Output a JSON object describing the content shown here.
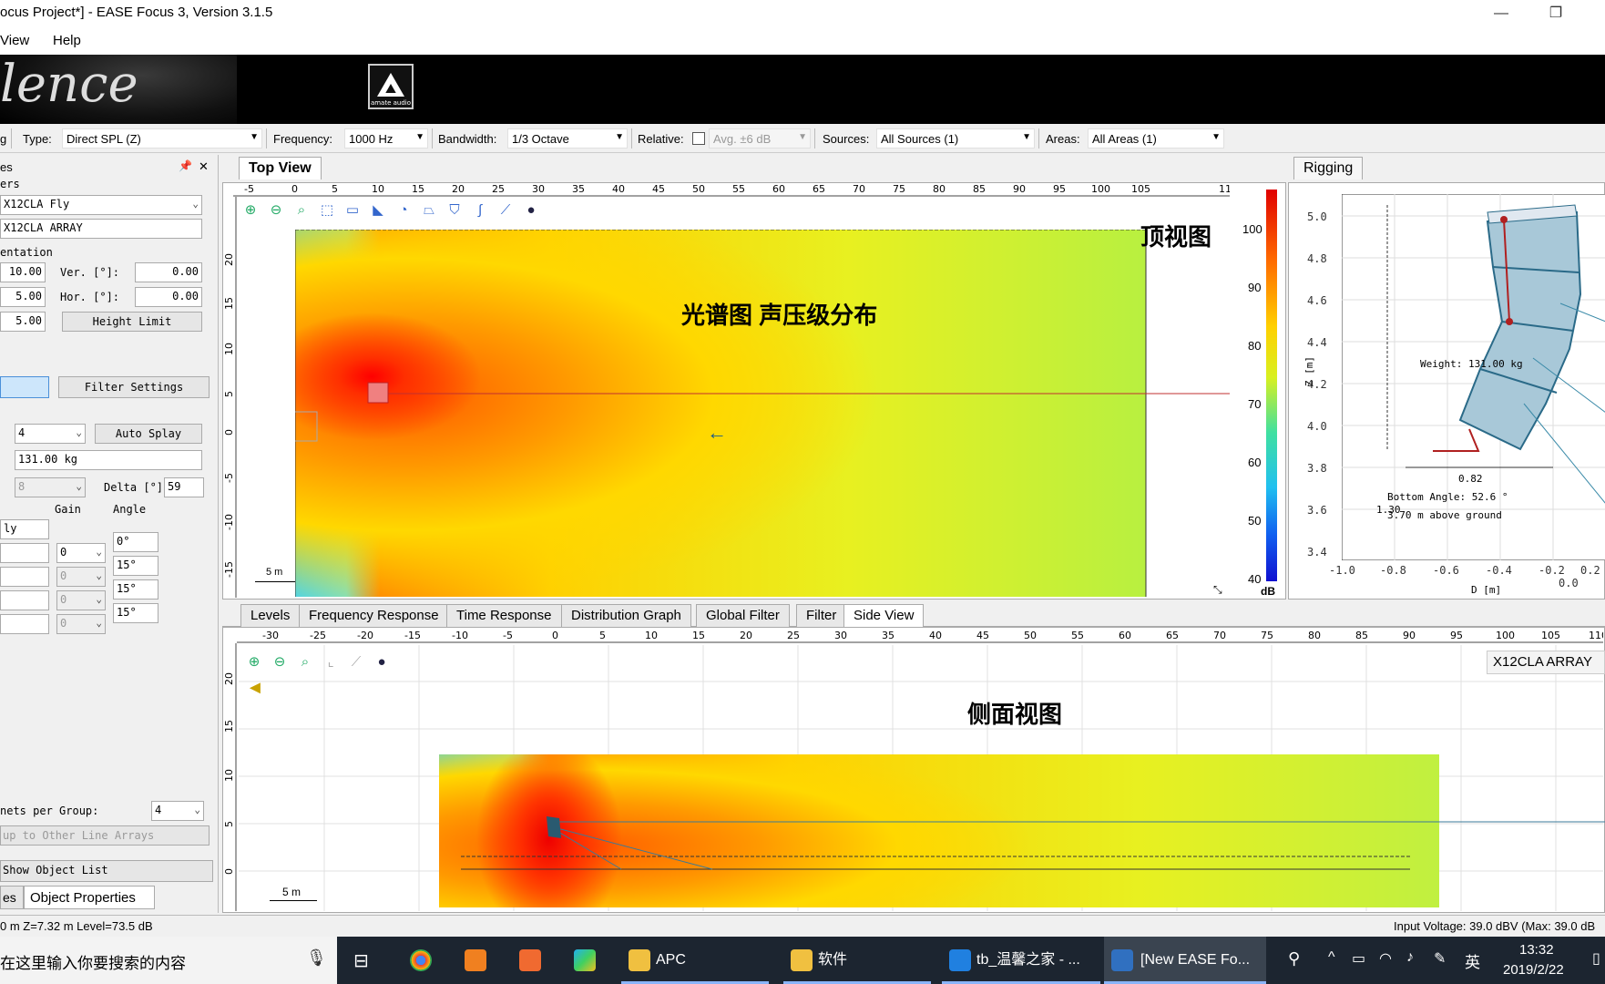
{
  "window": {
    "title": "ocus Project*] - EASE Focus 3, Version 3.1.5",
    "minimize": "—",
    "restore": "❐"
  },
  "menu": [
    "View",
    "Help"
  ],
  "banner": {
    "logo_text": "lence",
    "brand_logo_label": "amate audio"
  },
  "toolbar": {
    "partial_left": "g",
    "type_label": "Type:",
    "type_value": "Direct SPL (Z)",
    "frequency_label": "Frequency:",
    "frequency_value": "1000 Hz",
    "bandwidth_label": "Bandwidth:",
    "bandwidth_value": "1/3 Octave",
    "relative_label": "Relative:",
    "relative_value": "Avg. ±6 dB",
    "sources_label": "Sources:",
    "sources_value": "All Sources (1)",
    "areas_label": "Areas:",
    "areas_value": "All Areas (1)"
  },
  "left_panel": {
    "header": "es",
    "header_pin": "📌",
    "header_close": "✕",
    "section_ers": "ers",
    "model": "X12CLA Fly",
    "name": "X12CLA ARRAY",
    "section_orientation": "entation",
    "pos1": "10.00",
    "ver_label": "Ver. [°]:",
    "ver_value": "0.00",
    "pos2": "5.00",
    "hor_label": "Hor. [°]:",
    "hor_value": "0.00",
    "pos3": "5.00",
    "height_limit": "Height Limit",
    "filter_settings": "Filter Settings",
    "count": "4",
    "auto_splay": "Auto Splay",
    "weight": "131.00 kg",
    "count2": "8",
    "delta_label": "Delta [°]:",
    "delta_value": "59",
    "gain_label": "Gain",
    "angle_label": "Angle",
    "row_label": "ly",
    "gains": [
      "0",
      "0",
      "0",
      "0"
    ],
    "angles": [
      "0°",
      "15°",
      "15°",
      "15°"
    ],
    "cabinets_label": "nets per Group:",
    "cabinets_value": "4",
    "copy_btn": "up to Other Line Arrays",
    "show_object_list": "Show Object List",
    "tab_left": "es",
    "tab_object_properties": "Object Properties"
  },
  "top_view": {
    "tab": "Top View",
    "annotation_title": "顶视图",
    "annotation_main": "光谱图  声压级分布",
    "scale_bar": "5 m",
    "ruler_h": [
      "-5",
      "0",
      "5",
      "10",
      "15",
      "20",
      "25",
      "30",
      "35",
      "40",
      "45",
      "50",
      "55",
      "60",
      "65",
      "70",
      "75",
      "80",
      "85",
      "90",
      "95",
      "100",
      "105",
      "11"
    ],
    "ruler_v": [
      "20",
      "15",
      "10",
      "5",
      "0",
      "-5",
      "-10",
      "-15"
    ]
  },
  "color_scale": {
    "ticks": [
      "100",
      "90",
      "80",
      "70",
      "60",
      "50",
      "40"
    ],
    "unit": "dB"
  },
  "rigging": {
    "tab": "Rigging",
    "weight": "Weight: 131.00 kg",
    "height_dim": "1.30",
    "width_dim": "0.82",
    "bottom_angle": "Bottom Angle: 52.6 °",
    "above_ground": "3.70 m above ground",
    "z_label": "Z [m]",
    "d_label": "D [m]",
    "y_ticks": [
      "5.0",
      "4.8",
      "4.6",
      "4.4",
      "4.2",
      "4.0",
      "3.8",
      "3.6",
      "3.4"
    ],
    "x_ticks": [
      "-1.0",
      "-0.8",
      "-0.6",
      "-0.4",
      "-0.2",
      "0.0",
      "0.2"
    ]
  },
  "bottom_tabs": [
    "Levels",
    "Frequency Response",
    "Time Response",
    "Distribution Graph",
    "Global Filter",
    "Filter",
    "Side View"
  ],
  "side_view": {
    "array_label": "X12CLA ARRAY",
    "annotation": "侧面视图",
    "scale_bar": "5 m",
    "ruler_h": [
      "-30",
      "-25",
      "-20",
      "-15",
      "-10",
      "-5",
      "0",
      "5",
      "10",
      "15",
      "20",
      "25",
      "30",
      "35",
      "40",
      "45",
      "50",
      "55",
      "60",
      "65",
      "70",
      "75",
      "80",
      "85",
      "90",
      "95",
      "100",
      "105",
      "110"
    ],
    "ruler_v": [
      "20",
      "15",
      "10",
      "5",
      "0"
    ]
  },
  "status": {
    "left": "0 m Z=7.32 m Level=73.5 dB",
    "right": "Input Voltage: 39.0 dBV (Max: 39.0 dB"
  },
  "taskbar": {
    "search_placeholder": "在这里输入你要搜索的内容",
    "apps": [
      "APC",
      "软件",
      "tb_温馨之家 - ...",
      "[New EASE Fo..."
    ],
    "ime": "英",
    "time": "13:32",
    "date": "2019/2/22"
  },
  "colors": {
    "accent": "#1c2530",
    "scale_top": "#e00000",
    "scale_bottom": "#1010d0"
  }
}
